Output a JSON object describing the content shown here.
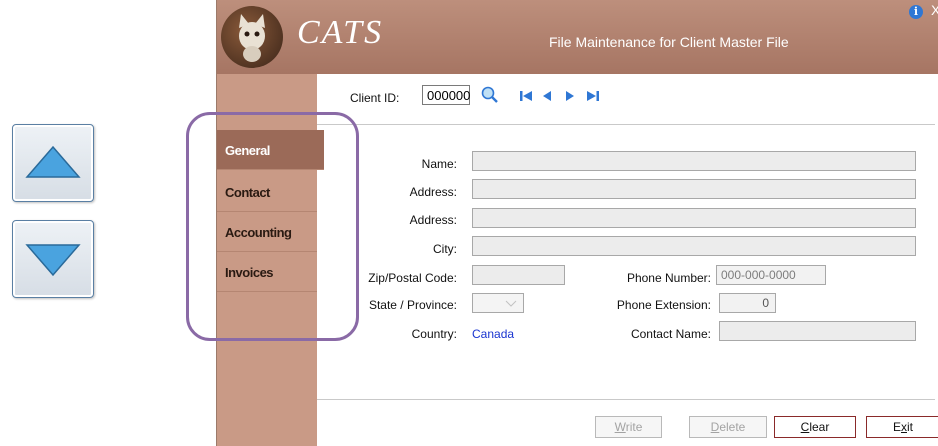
{
  "window": {
    "app_name": "CATS",
    "title": "File Maintenance for Client Master File",
    "info_glyph": "i",
    "close_glyph": "X"
  },
  "sidebar": {
    "tabs": [
      {
        "label": "General",
        "active": true
      },
      {
        "label": "Contact",
        "active": false
      },
      {
        "label": "Accounting",
        "active": false
      },
      {
        "label": "Invoices",
        "active": false
      }
    ]
  },
  "client": {
    "label": "Client ID:",
    "value": "000000"
  },
  "form": {
    "name_label": "Name:",
    "address1_label": "Address:",
    "address2_label": "Address:",
    "city_label": "City:",
    "zip_label": "Zip/Postal Code:",
    "state_label": "State / Province:",
    "country_label": "Country:",
    "country_value": "Canada",
    "phone_label": "Phone Number:",
    "phone_value": "000-000-0000",
    "ext_label": "Phone Extension:",
    "ext_value": "0",
    "contact_label": "Contact Name:"
  },
  "buttons": {
    "write": {
      "first": "W",
      "rest": "rite"
    },
    "delete": {
      "first": "D",
      "rest": "elete"
    },
    "clear": {
      "first": "C",
      "rest": "lear"
    },
    "exit": {
      "first": "E",
      "mid": "x",
      "rest": "it"
    }
  },
  "colors": {
    "titlebar": "#a67563",
    "sidebar": "#c99a86",
    "active_tab": "#9b6a58",
    "highlight": "#8a6aa6",
    "arrow_blue": "#4aa3df"
  }
}
